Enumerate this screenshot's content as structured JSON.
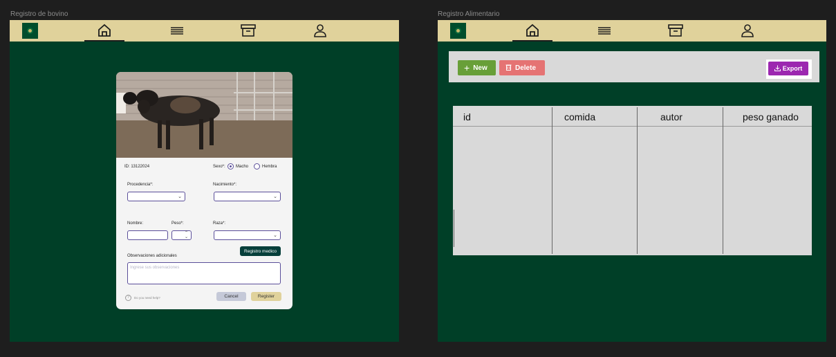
{
  "frames": {
    "left_label": "Registro de bovino",
    "right_label": "Registro Alimentario"
  },
  "nav": {
    "icons": [
      "home-icon",
      "menu-lines-icon",
      "archive-icon",
      "user-icon"
    ],
    "active": "home-icon"
  },
  "form": {
    "id_label": "ID: 13122024",
    "sexo_label": "Sexo*:",
    "sexo_options": [
      "Macho",
      "Hembra"
    ],
    "sexo_selected": "Macho",
    "procedencia_label": "Procedencia*:",
    "nacimiento_label": "Nacimiento*:",
    "nombre_label": "Nombre:",
    "peso_label": "Peso*:",
    "raza_label": "Raza*:",
    "registro_medico_button": "Registro medico",
    "observaciones_label": "Observaciones adicionales",
    "observaciones_placeholder": "Ingrese sus observaciones",
    "help_text": "Do you need help?",
    "cancel_button": "Cancel",
    "register_button": "Register"
  },
  "toolbar": {
    "new_label": "New",
    "delete_label": "Delete",
    "export_label": "Export"
  },
  "table": {
    "columns": [
      "id",
      "comida",
      "autor",
      "peso ganado"
    ]
  },
  "colors": {
    "frame_bg": "#003f27",
    "navbar": "#e0d29b",
    "new": "#689f38",
    "delete": "#e57373",
    "export": "#9c27b0",
    "registro_medico": "#063f3a"
  }
}
